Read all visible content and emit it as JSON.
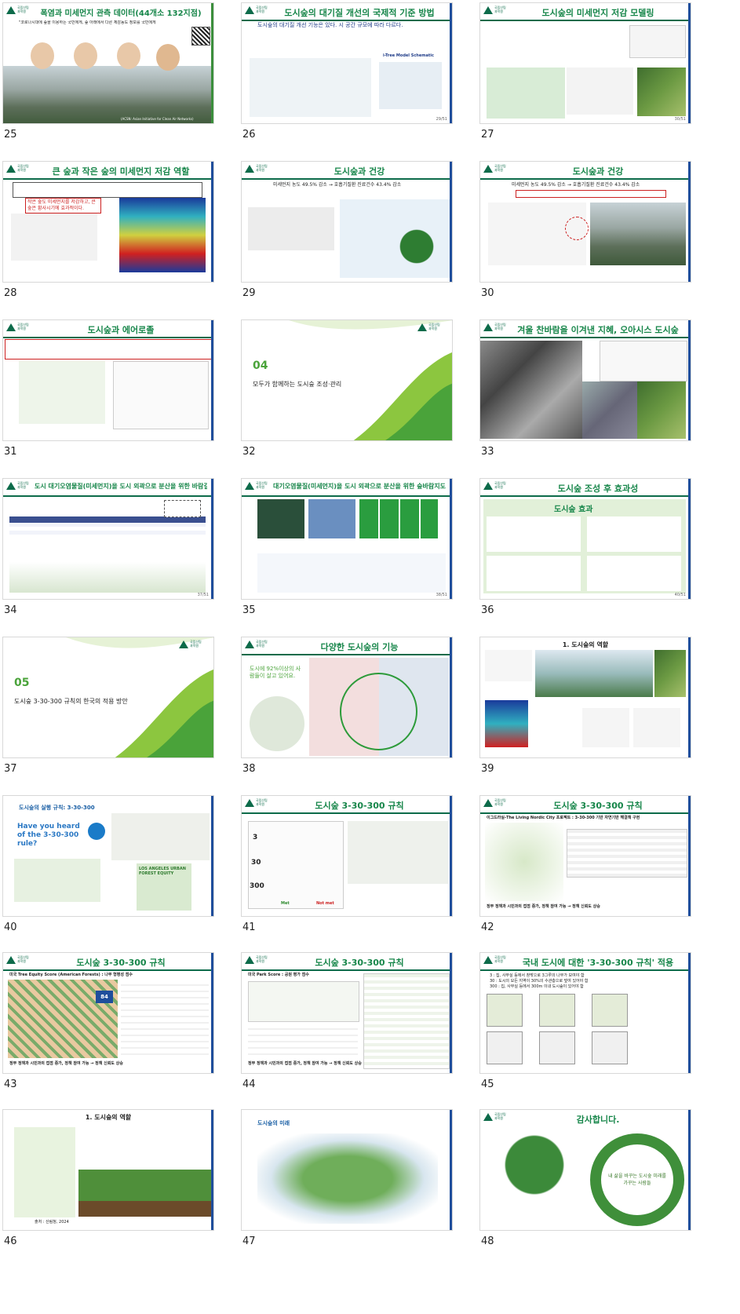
{
  "slides": [
    {
      "num": "25",
      "title": "폭염과 미세먼지 관측 데이터(44개소 132지점)",
      "sub": "\"코로나시대에 숲을 이용하는 국민에게, 숲 아래에서 다른 체감농도 정보를 국민에게",
      "foot": "(ACSN: Asian Initiative for Clean Air Networks)"
    },
    {
      "num": "26",
      "title": "도시숲의 대기질 개선의 국제적 기준 방법",
      "sub": "도시숲의 대기질 개선 기능은 있다. 시 공간 규모에 따라 다르다.",
      "label": "i-Tree Model Schematic",
      "page": "29/51"
    },
    {
      "num": "27",
      "title": "도시숲의 미세먼지 저감 모델링",
      "page": "30/51"
    },
    {
      "num": "28",
      "title": "큰 숲과 작은 숲의 미세먼지 저감 역할",
      "note": "작은 숲도 미세먼지를 저감하고, 큰 숲은 황사시기에 효과적이다."
    },
    {
      "num": "29",
      "title": "도시숲과 건강",
      "sub": "미세먼지 농도 49.5% 감소 → 호흡기질환 진료건수 43.4% 감소"
    },
    {
      "num": "30",
      "title": "도시숲과 건강",
      "sub": "미세먼지 농도 49.5% 감소 → 호흡기질환 진료건수 43.4% 감소"
    },
    {
      "num": "31",
      "title": "도시숲과 에어로졸"
    },
    {
      "num": "32",
      "snum": "04",
      "stitle": "모두가 함께하는 도시숲 조성·관리"
    },
    {
      "num": "33",
      "title": "겨울 찬바람을 이겨낸 지혜, 오아시스 도시숲"
    },
    {
      "num": "34",
      "title": "도시 대기오염물질(미세먼지)을 도시 외곽으로 분산을 위한 바람길숲",
      "page": "37/51"
    },
    {
      "num": "35",
      "title": "대기오염물질(미세먼지)을 도시 외곽으로 분산을 위한 숲바람지도",
      "page": "38/51"
    },
    {
      "num": "36",
      "title": "도시숲 조성 후 효과성",
      "head": "도시숲 효과",
      "page": "40/51"
    },
    {
      "num": "37",
      "snum": "05",
      "stitle": "도시숲 3-30-300 규칙의 한국의 적용 방안"
    },
    {
      "num": "38",
      "title": "다양한 도시숲의 기능",
      "sub": "도시에 92%이상의 사람들이 살고 있어요."
    },
    {
      "num": "39",
      "title": "1. 도시숲의 역할"
    },
    {
      "num": "40",
      "title": "도시숲의 실행 규칙: 3-30-300",
      "q": "Have you heard of the 3-30-300 rule?",
      "la": "LOS ANGELES URBAN FOREST EQUITY"
    },
    {
      "num": "41",
      "title": "도시숲 3-30-300 규칙",
      "nums": [
        "3",
        "30",
        "300"
      ],
      "pass": "Met",
      "fail": "Not met"
    },
    {
      "num": "42",
      "title": "도시숲 3-30-300 규칙",
      "sub": "이그드라실-The Living Nordic City 프로젝트 : 3-30-300 기반 자연기반 해결책 구현",
      "foot": "정부 정책과 시민과의 접점 증가, 정책 참여 가능 → 정책 신뢰도 상승"
    },
    {
      "num": "43",
      "title": "도시숲 3-30-300 규칙",
      "sub": "미국 Tree Equity Score (American Forests) : 나무 형평성 점수",
      "score": "84",
      "foot": "정부 정책과 시민과의 접점 증가, 정책 참여 가능 → 정책 신뢰도 상승"
    },
    {
      "num": "44",
      "title": "도시숲 3-30-300 규칙",
      "sub": "미국 Park Score : 공원 평가 점수",
      "foot": "정부 정책과 시민과의 접점 증가, 정책 참여 가능 → 정책 신뢰도 상승"
    },
    {
      "num": "45",
      "title": "국내 도시에 대한 '3-30-300 규칙' 적용",
      "lines": [
        "3 : 집, 사무실 등에서 창밖으로 3그루의 나무가 보여야 함",
        "30 : 도시의 모든 지역이 30%의 수관층으로 덮여 있어야 함",
        "300 : 집, 사무실 등에서 300m 이내 도시숲이 있어야 함"
      ]
    },
    {
      "num": "46",
      "title": "1. 도시숲의 역할",
      "foot": "출처 : 산림청, 2024"
    },
    {
      "num": "47",
      "title": "도시숲의 미래"
    },
    {
      "num": "48",
      "title": "감사합니다.",
      "ring": "내 삶을 바꾸는 도시숲 미래를 가꾸는 사람들"
    }
  ],
  "colors": {
    "green": "#17864a",
    "darkgreen": "#0d6b4a",
    "blue": "#1f4e9c",
    "red": "#cc2020",
    "lightgreen": "#8cc63f"
  }
}
